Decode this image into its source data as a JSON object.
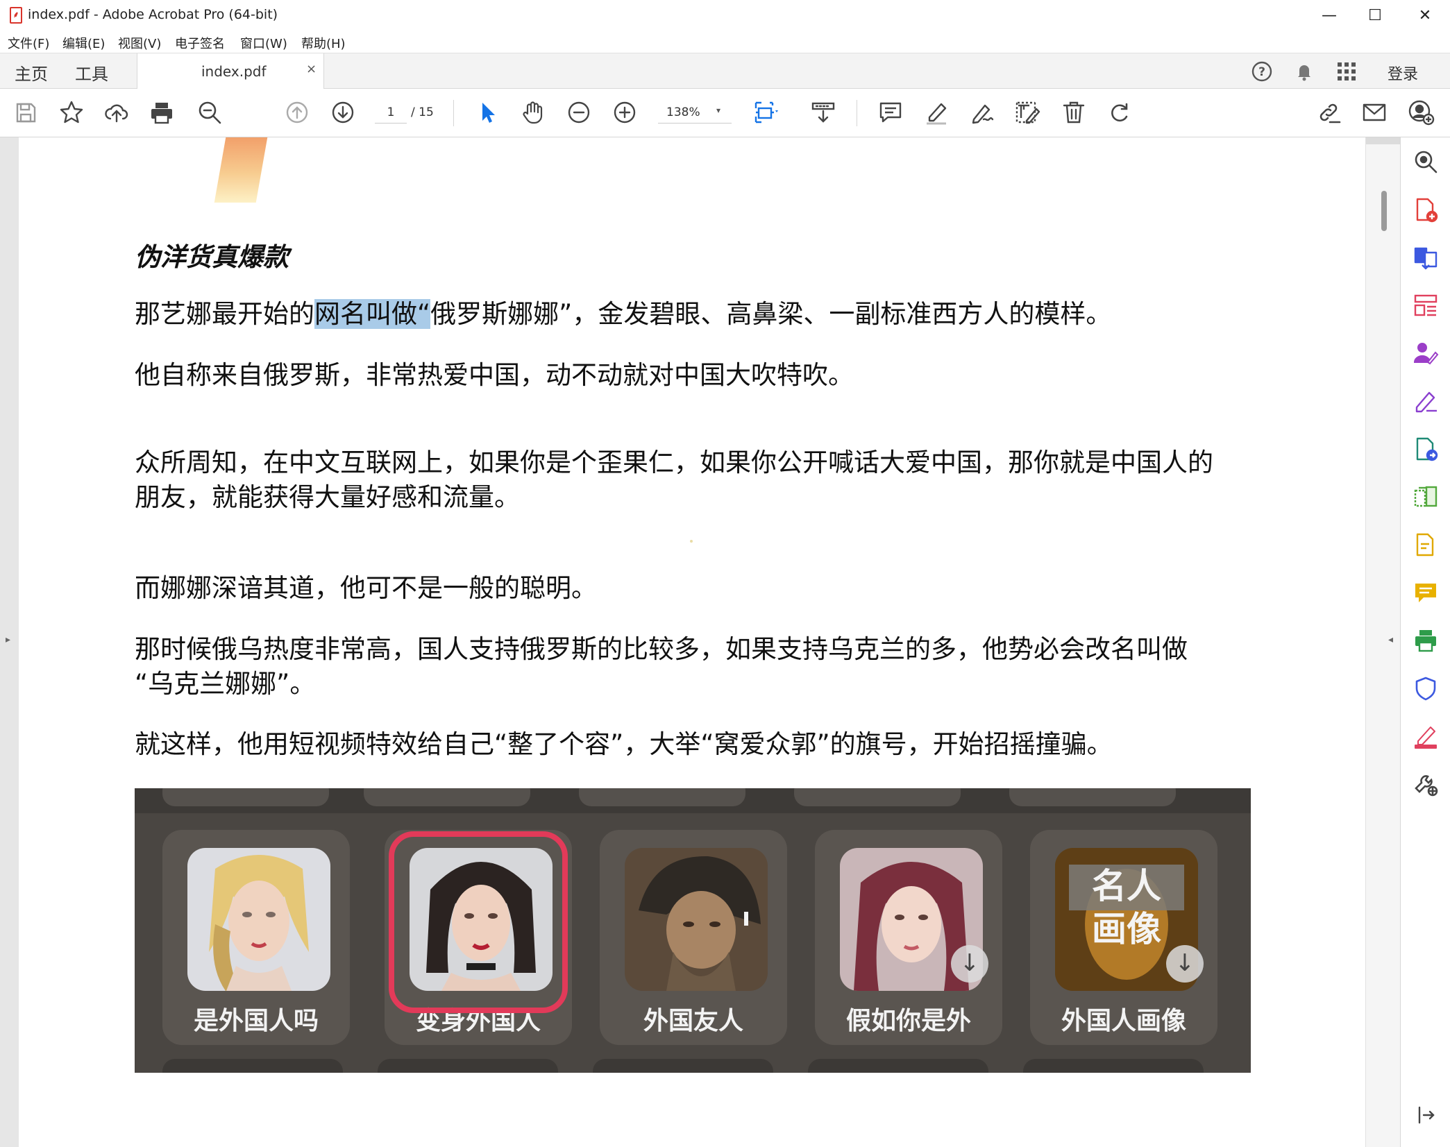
{
  "window": {
    "title": "index.pdf - Adobe Acrobat Pro (64-bit)",
    "minimize": "—",
    "maximize": "☐",
    "close": "✕"
  },
  "menu": [
    "文件(F)",
    "编辑(E)",
    "视图(V)",
    "电子签名",
    "窗口(W)",
    "帮助(H)"
  ],
  "tabs": {
    "home": "主页",
    "tools": "工具",
    "document": "index.pdf",
    "document_close": "×"
  },
  "header": {
    "signin": "登录",
    "icons": [
      "help-icon",
      "bell-icon",
      "apps-grid-icon"
    ]
  },
  "toolbar": {
    "page_current": "1",
    "page_total": "/ 15",
    "zoom": "138%",
    "zoom_caret": "▾",
    "accent_color": "#1473e6"
  },
  "document": {
    "heading": "伪洋货真爆款",
    "paragraphs": [
      {
        "before": "那艺娜最开始的",
        "highlight": "网名叫做“",
        "after": "俄罗斯娜娜”，金发碧眼、高鼻梁、一副标准西方人的模样。"
      },
      {
        "lines": [
          "他自称来自俄罗斯，非常热爱中国，动不动就对中国大吹特吹。"
        ]
      },
      {
        "lines": [
          "众所周知，在中文互联网上，如果你是个歪果仁，如果你公开喊话大爱中国，那你就是中国人的",
          "朋友，就能获得大量好感和流量。"
        ]
      },
      {
        "lines": [
          "而娜娜深谙其道，他可不是一般的聪明。"
        ]
      },
      {
        "lines": [
          "那时候俄乌热度非常高，国人支持俄罗斯的比较多，如果支持乌克兰的多，他势必会改名叫做",
          "“乌克兰娜娜”。"
        ]
      },
      {
        "lines": [
          "就这样，他用短视频特效给自己“整了个容”，大举“窝爱众郭”的旗号，开始招摇撞骗。"
        ]
      }
    ],
    "image": {
      "filters": [
        {
          "label": "是外国人吗",
          "download": false
        },
        {
          "label": "变身外国人",
          "download": false,
          "selected": true
        },
        {
          "label": "外国友人",
          "download": false
        },
        {
          "label": "假如你是外",
          "download": true
        },
        {
          "label": "外国人画像",
          "download": true,
          "overlay": "名人\n画像"
        }
      ],
      "overlay_line1": "名人",
      "overlay_line2": "画像",
      "download_glyph": "↓",
      "highlight_color": "#e23a59"
    }
  },
  "right_tools": [
    "zoom-icon",
    "create-pdf-icon",
    "combine-files-icon",
    "organize-pages-icon",
    "request-signature-icon",
    "fill-sign-icon",
    "export-pdf-icon",
    "compare-icon",
    "edit-pdf-icon",
    "comment-icon",
    "print-production-icon",
    "protect-icon",
    "redact-icon",
    "more-tools-icon",
    "collapse-panel-icon"
  ],
  "panel_arrows": {
    "left": "▸",
    "right": "◂"
  }
}
